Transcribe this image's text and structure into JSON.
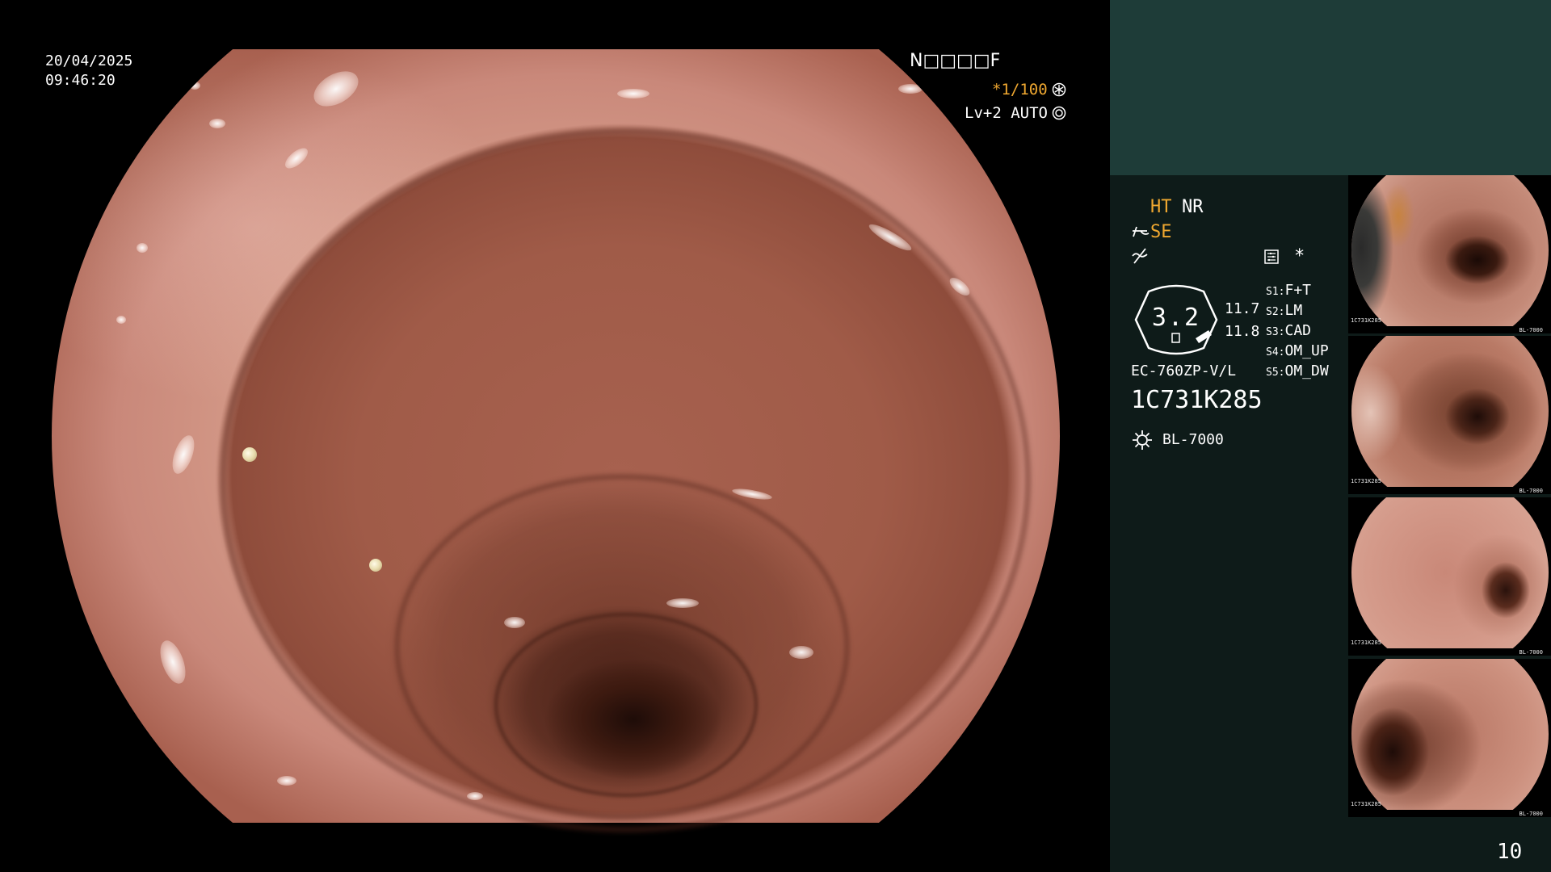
{
  "osd": {
    "date": "20/04/2025",
    "time": "09:46:20",
    "patient_id": "N□□□□F",
    "shutter": "*1/100",
    "iris": "Lv+2 AUTO",
    "page_number": "10"
  },
  "panel": {
    "ht_label": "HT",
    "nr_label": "NR",
    "se_label": "SE",
    "mark": "*",
    "zoom": "3.2",
    "readings": [
      "11.7",
      "11.8"
    ],
    "switches": [
      {
        "key": "S1:",
        "value": "F+T"
      },
      {
        "key": "S2:",
        "value": "LM"
      },
      {
        "key": "S3:",
        "value": "CAD"
      },
      {
        "key": "S4:",
        "value": "OM_UP"
      },
      {
        "key": "S5:",
        "value": "OM_DW"
      }
    ],
    "scope_model": "EC-760ZP-V/L",
    "scope_serial": "1C731K285",
    "light_source": "BL-7000"
  },
  "thumbnails": [
    {
      "serial": "1C731K285",
      "light_source": "BL-7000"
    },
    {
      "serial": "1C731K285",
      "light_source": "BL-7000"
    },
    {
      "serial": "1C731K285",
      "light_source": "BL-7000"
    },
    {
      "serial": "1C731K285",
      "light_source": "BL-7000"
    }
  ],
  "icons": {
    "shutter": "shutter-icon",
    "iris": "auto-iris-icon",
    "structure": "structure-enhancement-icon",
    "color": "color-mode-icon",
    "memo": "memo-icon",
    "light": "light-source-icon"
  },
  "colors": {
    "accent": "#f0a830",
    "text": "#ffffff",
    "background": "#000000",
    "panel_top": "#1e3c38",
    "panel": "#0e1b19"
  }
}
